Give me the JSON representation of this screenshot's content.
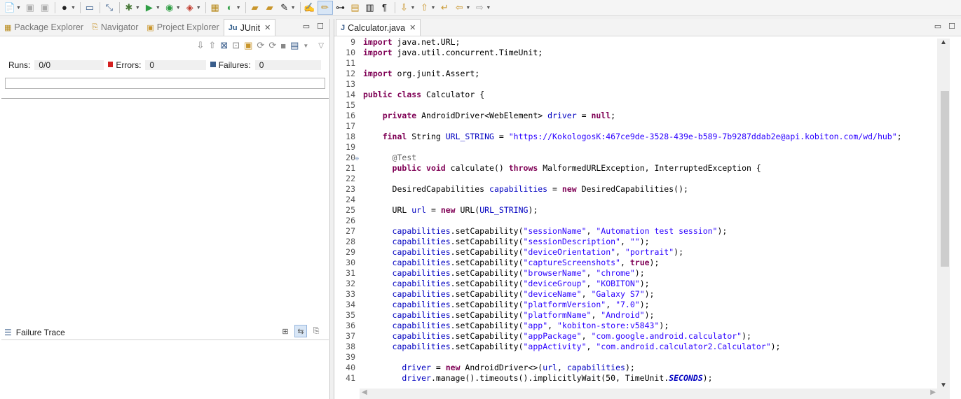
{
  "colors": {
    "keyword": "#7f0055",
    "string": "#2a00ff",
    "field": "#0000c0",
    "annotation": "#646464",
    "error_red": "#d42020",
    "failure_blue": "#3a5e8c"
  },
  "toolbar": {
    "icons": [
      "new-icon",
      "save-icon",
      "save-all-icon",
      "user-icon",
      "terminal-icon",
      "skip-breakpoints-icon",
      "debug-icon",
      "run-icon",
      "coverage-icon",
      "external-tools-icon",
      "new-package-icon",
      "new-class-icon",
      "open-type-icon",
      "open-folder-icon",
      "search-icon",
      "toggle-mark-occurrences-icon",
      "pen-icon",
      "history-icon",
      "show-whitespace-icon",
      "pilcrow-icon",
      "next-annotation-icon",
      "prev-annotation-icon",
      "back-to-last-edit-icon",
      "back-icon",
      "forward-icon"
    ]
  },
  "left_panel": {
    "tabs": [
      {
        "label": "Package Explorer",
        "icon": "package-icon"
      },
      {
        "label": "Navigator",
        "icon": "navigator-icon"
      },
      {
        "label": "Project Explorer",
        "icon": "project-icon"
      },
      {
        "label": "JUnit",
        "icon": "junit-icon"
      }
    ],
    "runs_label": "Runs:",
    "runs_value": "0/0",
    "errors_label": "Errors:",
    "errors_value": "0",
    "failures_label": "Failures:",
    "failures_value": "0",
    "failure_trace_label": "Failure Trace"
  },
  "editor": {
    "tab_label": "Calculator.java",
    "lines": [
      {
        "n": "9",
        "t": "import java.net.URL;"
      },
      {
        "n": "10",
        "t": "import java.util.concurrent.TimeUnit;"
      },
      {
        "n": "11",
        "t": ""
      },
      {
        "n": "12",
        "t": "import org.junit.Assert;"
      },
      {
        "n": "13",
        "t": ""
      },
      {
        "n": "14",
        "t": "public class Calculator {"
      },
      {
        "n": "15",
        "t": ""
      },
      {
        "n": "16",
        "t": "    private AndroidDriver<WebElement> driver = null;"
      },
      {
        "n": "17",
        "t": ""
      },
      {
        "n": "18",
        "t": "    final String URL_STRING = \"https://KokologosK:467ce9de-3528-439e-b589-7b9287ddab2e@api.kobiton.com/wd/hub\";"
      },
      {
        "n": "19",
        "t": ""
      },
      {
        "n": "20",
        "t": "      @Test"
      },
      {
        "n": "21",
        "t": "      public void calculate() throws MalformedURLException, InterruptedException {"
      },
      {
        "n": "22",
        "t": ""
      },
      {
        "n": "23",
        "t": "      DesiredCapabilities capabilities = new DesiredCapabilities();"
      },
      {
        "n": "24",
        "t": ""
      },
      {
        "n": "25",
        "t": "      URL url = new URL(URL_STRING);"
      },
      {
        "n": "26",
        "t": ""
      },
      {
        "n": "27",
        "t": "      capabilities.setCapability(\"sessionName\", \"Automation test session\");"
      },
      {
        "n": "28",
        "t": "      capabilities.setCapability(\"sessionDescription\", \"\");"
      },
      {
        "n": "29",
        "t": "      capabilities.setCapability(\"deviceOrientation\", \"portrait\");"
      },
      {
        "n": "30",
        "t": "      capabilities.setCapability(\"captureScreenshots\", true);"
      },
      {
        "n": "31",
        "t": "      capabilities.setCapability(\"browserName\", \"chrome\");"
      },
      {
        "n": "32",
        "t": "      capabilities.setCapability(\"deviceGroup\", \"KOBITON\");"
      },
      {
        "n": "33",
        "t": "      capabilities.setCapability(\"deviceName\", \"Galaxy S7\");"
      },
      {
        "n": "34",
        "t": "      capabilities.setCapability(\"platformVersion\", \"7.0\");"
      },
      {
        "n": "35",
        "t": "      capabilities.setCapability(\"platformName\", \"Android\");"
      },
      {
        "n": "36",
        "t": "      capabilities.setCapability(\"app\", \"kobiton-store:v5843\");"
      },
      {
        "n": "37",
        "t": "      capabilities.setCapability(\"appPackage\", \"com.google.android.calculator\");"
      },
      {
        "n": "38",
        "t": "      capabilities.setCapability(\"appActivity\", \"com.android.calculator2.Calculator\");"
      },
      {
        "n": "39",
        "t": ""
      },
      {
        "n": "40",
        "t": "        driver = new AndroidDriver<>(url, capabilities);"
      },
      {
        "n": "41",
        "t": "        driver.manage().timeouts().implicitlyWait(50, TimeUnit.SECONDS);"
      }
    ]
  }
}
